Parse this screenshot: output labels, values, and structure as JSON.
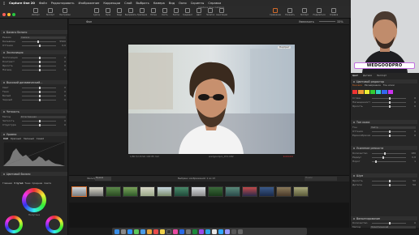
{
  "menubar": {
    "app_name": "Capture One 20",
    "items": [
      "Файл",
      "Редактировать",
      "Изображение",
      "Коррекции",
      "Слой",
      "Выбрать",
      "Камера",
      "Вид",
      "Окно",
      "Скрипты",
      "Справка"
    ],
    "clock": "Пт 11:33"
  },
  "window_title": "Capture One Catalog",
  "toolbar": {
    "buttons": [
      "Импорт",
      "Экспорт",
      "Настройки",
      "Курсор",
      "Лупа",
      "Кадр",
      "Выпрямить",
      "Трапеция",
      "Пятна",
      "Кисть",
      "Ластик",
      "Градиент",
      "Цвет",
      "Пипетка",
      "Аннотация",
      "Сравнение",
      "Показать",
      "Экспорт",
      "Поделиться",
      "Справка"
    ]
  },
  "left_panel": {
    "white_balance": {
      "title": "Баланс белого",
      "mode_label": "Режим",
      "mode_value": "Снимок",
      "kelvin_label": "Кельвины",
      "kelvin_value": "5500",
      "tint_label": "Оттенок",
      "tint_value": "0,0"
    },
    "exposure": {
      "title": "Экспозиция",
      "rows": [
        {
          "label": "Экспозиция",
          "value": "0"
        },
        {
          "label": "Контраст",
          "value": "0"
        },
        {
          "label": "Яркость",
          "value": "0"
        },
        {
          "label": "Насыщ.",
          "value": "0"
        }
      ]
    },
    "hdr": {
      "title": "Высокий динамический...",
      "rows": [
        {
          "label": "Свет",
          "value": "0"
        },
        {
          "label": "Тени",
          "value": "0"
        },
        {
          "label": "Белый",
          "value": "0"
        },
        {
          "label": "Черный",
          "value": "0"
        }
      ]
    },
    "clarity": {
      "title": "Четкость",
      "method_label": "Метод",
      "method_value": "Естественная",
      "rows": [
        {
          "label": "Четкость",
          "value": "0"
        },
        {
          "label": "Структура",
          "value": "0"
        }
      ]
    },
    "levels": {
      "title": "Уровни",
      "channels": [
        "RGB",
        "Красный",
        "Зеленый",
        "Синий"
      ]
    },
    "color_balance": {
      "title": "Цветовой баланс",
      "tabs": [
        "Главная",
        "3 путей",
        "Тени",
        "Средние",
        "Света"
      ],
      "wheel_label": "Полутона"
    }
  },
  "viewer": {
    "label": "Фон",
    "right_label": "Увеличить",
    "zoom": "33%",
    "photo_tag": "Портрет",
    "info_left": "1/80 f/2,8 ISO 100 85 mm",
    "info_center": "wedgoodpro_072.CR2",
    "info_right": "★★★★★"
  },
  "filmstrip": {
    "sort_label": "Фильтр",
    "sort_value": "Время",
    "count_text": "Выбрано изображений: 1 из 13",
    "search_placeholder": "Поиск"
  },
  "right_panel": {
    "watermark": "WEDGOODPRO",
    "tabs": [
      "Цвет",
      "Детали",
      "Экспорт"
    ],
    "color_editor": {
      "title": "Цветовой редактор",
      "tabs": [
        "Базовое",
        "Расширенное",
        "Тон кожи"
      ],
      "rows": [
        {
          "label": "Сглаж.",
          "value": "0"
        },
        {
          "label": "Насыщенность",
          "value": "0"
        },
        {
          "label": "Яркость",
          "value": "0"
        }
      ]
    },
    "skin_tone": {
      "title": "Тон кожи",
      "rows": [
        {
          "label": "Тон",
          "value": "Нейтр."
        },
        {
          "label": "Оттенок",
          "value": "0"
        },
        {
          "label": "Единообразие",
          "value": "0"
        }
      ]
    },
    "sharpening": {
      "title": "Усиление резкости",
      "rows": [
        {
          "label": "Количество",
          "value": "180"
        },
        {
          "label": "Радиус",
          "value": "0,8"
        },
        {
          "label": "Порог",
          "value": "1"
        }
      ]
    },
    "noise": {
      "title": "Шум",
      "rows": [
        {
          "label": "Яркость",
          "value": "50"
        },
        {
          "label": "Детали",
          "value": "50"
        }
      ]
    },
    "vignette": {
      "title": "Виньетирование",
      "rows": [
        {
          "label": "Количество",
          "value": "0"
        },
        {
          "label": "Метод",
          "value": "Эллиптический"
        }
      ]
    }
  },
  "colors": {
    "accent": "#d26a2a",
    "panel": "#262626",
    "watermark_border": "#c26fe0"
  }
}
